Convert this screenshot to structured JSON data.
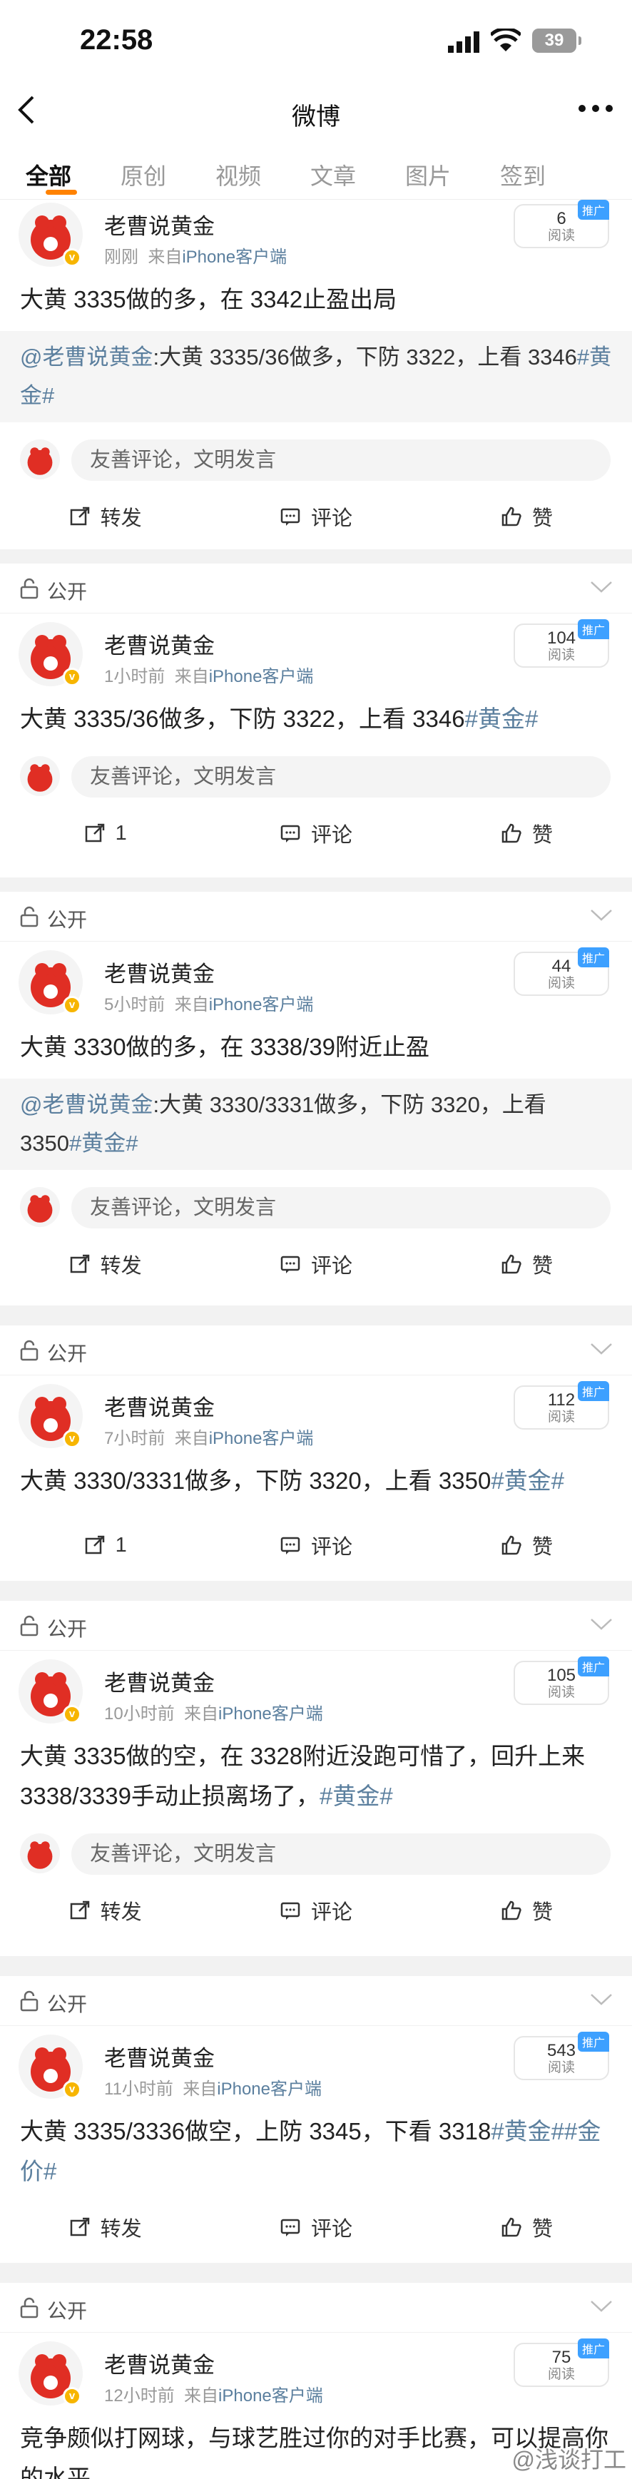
{
  "status": {
    "time": "22:58",
    "battery": "39"
  },
  "nav": {
    "title": "微博"
  },
  "tabs": [
    "全部",
    "原创",
    "视频",
    "文章",
    "图片",
    "签到"
  ],
  "visibility": "公开",
  "comment_placeholder": "友善评论，文明发言",
  "actions": {
    "repost": "转发",
    "comment": "评论",
    "like": "赞"
  },
  "read_label": "阅读",
  "promo": "推广",
  "posts": [
    {
      "user": "老曹说黄金",
      "time": "刚刚",
      "from": "来自",
      "source": "iPhone客户端",
      "reads": "6",
      "text": "大黄 3335做的多，在 3342止盈出局",
      "quote_at": "@老曹说黄金",
      "quote_text": ":大黄 3335/36做多，下防 3322，上看 3346",
      "quote_tag": "#黄金#"
    },
    {
      "user": "老曹说黄金",
      "time": "1小时前",
      "from": "来自",
      "source": "iPhone客户端",
      "reads": "104",
      "text": "大黄 3335/36做多，下防 3322，上看 3346",
      "tag": "#黄金#",
      "repost_count": "1"
    },
    {
      "user": "老曹说黄金",
      "time": "5小时前",
      "from": "来自",
      "source": "iPhone客户端",
      "reads": "44",
      "text": "大黄 3330做的多，在 3338/39附近止盈",
      "quote_at": "@老曹说黄金",
      "quote_text": ":大黄 3330/3331做多，下防 3320，上看 3350",
      "quote_tag": "#黄金#"
    },
    {
      "user": "老曹说黄金",
      "time": "7小时前",
      "from": "来自",
      "source": "iPhone客户端",
      "reads": "112",
      "text": "大黄 3330/3331做多，下防 3320，上看 3350",
      "tag": "#黄金#",
      "repost_count": "1"
    },
    {
      "user": "老曹说黄金",
      "time": "10小时前",
      "from": "来自",
      "source": "iPhone客户端",
      "reads": "105",
      "text": "大黄 3335做的空，在 3328附近没跑可惜了，回升上来 3338/3339手动止损离场了，",
      "tag": "#黄金#"
    },
    {
      "user": "老曹说黄金",
      "time": "11小时前",
      "from": "来自",
      "source": "iPhone客户端",
      "reads": "543",
      "text": "大黄 3335/3336做空，上防 3345，下看 3318",
      "tag": "#黄金##金价#"
    },
    {
      "user": "老曹说黄金",
      "time": "12小时前",
      "from": "来自",
      "source": "iPhone客户端",
      "reads": "75",
      "text": "竞争颇似打网球，与球艺胜过你的对手比赛，可以提高你的水平"
    }
  ],
  "watermark": "@浅谈打工"
}
